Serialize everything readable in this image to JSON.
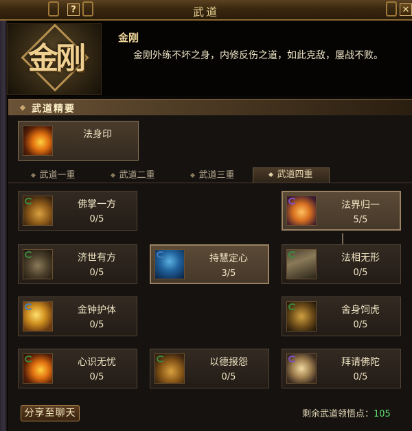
{
  "window": {
    "title": "武道",
    "help_label": "?",
    "close_label": "✕"
  },
  "header": {
    "emblem_text": "金刚",
    "skill_name": "金刚",
    "description": "金刚外练不坏之身，内修反伤之道，如此克敌，屡战不败。"
  },
  "section": {
    "title": "武道精要"
  },
  "top_skill": {
    "name": "法身印",
    "icon": "flame-hand-icon"
  },
  "tabs": [
    {
      "label": "武道一重"
    },
    {
      "label": "武道二重"
    },
    {
      "label": "武道三重"
    },
    {
      "label": "武道四重",
      "selected": true
    }
  ],
  "skills": [
    {
      "name": "佛掌一方",
      "level": "0/5",
      "icon": "palm-icon"
    },
    {
      "name": "法界归一",
      "level": "5/5",
      "icon": "magic-circle-icon"
    },
    {
      "name": "济世有方",
      "level": "0/5",
      "icon": "swastika-icon"
    },
    {
      "name": "持慧定心",
      "level": "3/5",
      "icon": "golden-figure-icon"
    },
    {
      "name": "法相无形",
      "level": "0/5",
      "icon": "stairs-icon"
    },
    {
      "name": "金钟护体",
      "level": "0/5",
      "icon": "golden-bell-icon"
    },
    {
      "name": "舍身饲虎",
      "level": "0/5",
      "icon": "tiger-icon"
    },
    {
      "name": "心识无忧",
      "level": "0/5",
      "icon": "swirl-icon"
    },
    {
      "name": "以德报怨",
      "level": "0/5",
      "icon": "glow-icon"
    },
    {
      "name": "拜请佛陀",
      "level": "0/5",
      "icon": "buddha-icon"
    }
  ],
  "footer": {
    "share_label": "分享至聊天",
    "points_label": "剩余武道领悟点：",
    "points_value": "105"
  }
}
